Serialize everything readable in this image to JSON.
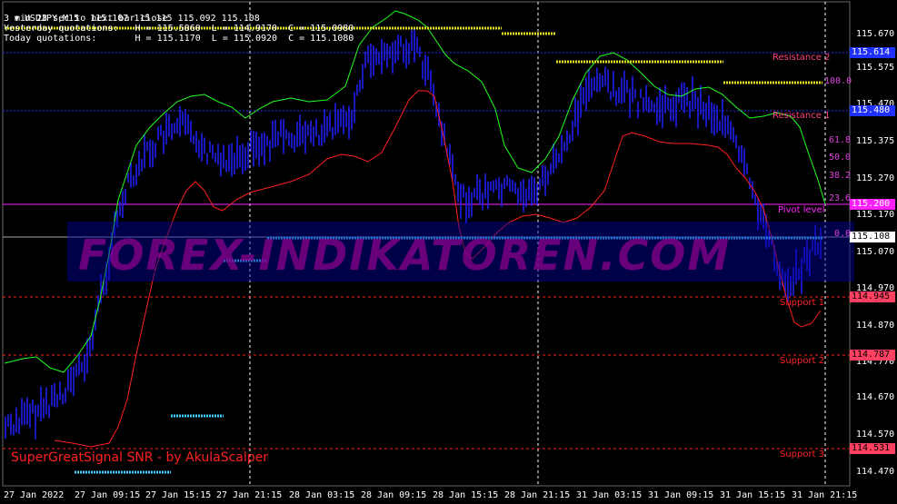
{
  "symbol_line": "USDJPY,M15  115.107 115.115 115.092 115.108",
  "timer_line": "3 min 28 sec to next bar close",
  "yesterday_line": "Yesterday quotations:   H = 115.5860  L = 114.9170  C = 115.0980",
  "today_line": "Today quotations:       H = 115.1170  L = 115.0920  C = 115.1080",
  "price_axis": [
    "115.670",
    "115.575",
    "115.470",
    "115.375",
    "115.270",
    "115.170",
    "115.070",
    "114.970",
    "114.870",
    "114.770",
    "114.670",
    "114.570",
    "114.470"
  ],
  "date_axis": [
    "27 Jan 2022",
    "27 Jan 09:15",
    "27 Jan 15:15",
    "27 Jan 21:15",
    "28 Jan 03:15",
    "28 Jan 09:15",
    "28 Jan 15:15",
    "28 Jan 21:15",
    "31 Jan 03:15",
    "31 Jan 09:15",
    "31 Jan 15:15",
    "31 Jan 21:15"
  ],
  "levels": {
    "resistance2": {
      "label": "Resistance 2",
      "value": "115.614"
    },
    "resistance1": {
      "label": "Resistance 1",
      "value": "115.480"
    },
    "pivot": {
      "label": "Pivot level",
      "value": "115.200"
    },
    "current": {
      "value": "115.108"
    },
    "support1": {
      "label": "Support 1",
      "value": "114.945"
    },
    "support2": {
      "label": "Support 2",
      "value": "114.787"
    },
    "support3": {
      "label": "Support 3",
      "value": "114.531"
    }
  },
  "fib_levels": [
    "100.0",
    "61.8",
    "50.0",
    "38.2",
    "23.6",
    "0.0"
  ],
  "footer_title": "SuperGreatSignal SNR - by AkulaScalper",
  "watermark": "FOREX-INDIKATOREN.COM",
  "colors": {
    "resistance": "#ff4080",
    "support": "#ff2020",
    "pivot": "#ff20ff",
    "band_upper": "#20ff20",
    "band_lower": "#ff2020",
    "candles": "#2020ff",
    "current": "#ffffff"
  }
}
